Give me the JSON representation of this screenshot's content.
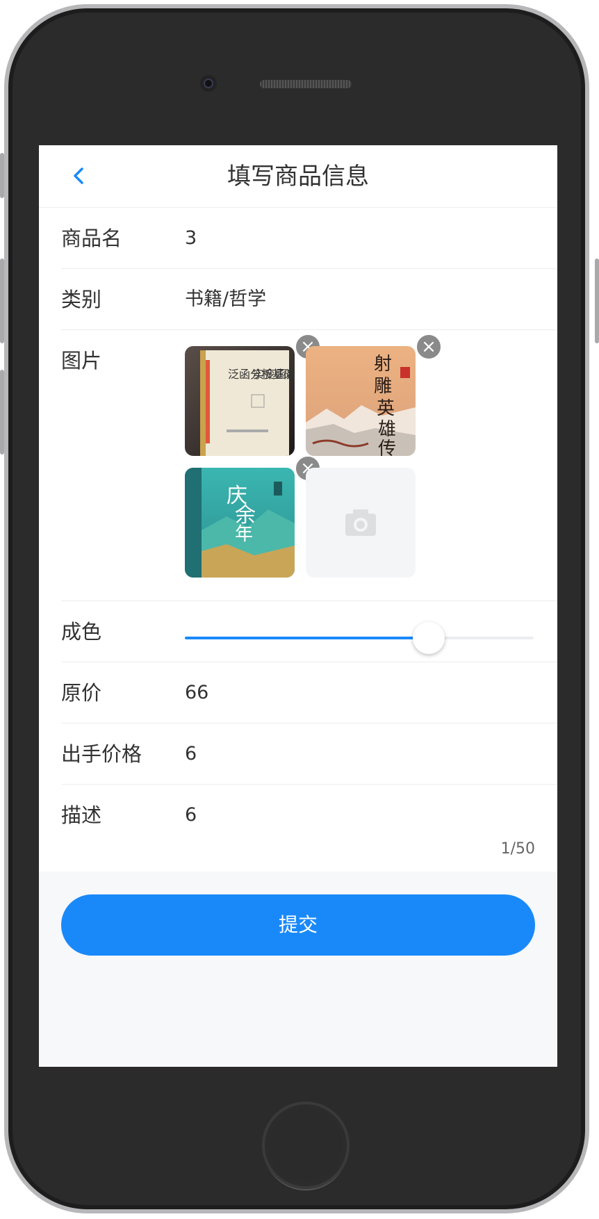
{
  "header": {
    "title": "填写商品信息",
    "back_icon": "chevron-left-icon"
  },
  "form": {
    "name": {
      "label": "商品名",
      "value": "3"
    },
    "category": {
      "label": "类别",
      "value": "书籍/哲学"
    },
    "images": {
      "label": "图片",
      "items": [
        {
          "alt": "实变函数与泛函分析基础 book cover",
          "title": "实变函数与泛函分析基础"
        },
        {
          "alt": "射雕英雄传 book cover",
          "title": "射雕英雄传"
        },
        {
          "alt": "庆余年 book cover",
          "title": "庆余年"
        }
      ],
      "delete_icon": "close-circle-icon",
      "upload_icon": "camera-icon"
    },
    "condition": {
      "label": "成色",
      "value_percent": 70
    },
    "original_price": {
      "label": "原价",
      "value": "66"
    },
    "sale_price": {
      "label": "出手价格",
      "value": "6"
    },
    "description": {
      "label": "描述",
      "value": "6",
      "counter": "1/50"
    }
  },
  "actions": {
    "submit_label": "提交"
  },
  "colors": {
    "accent": "#1989fa",
    "text": "#323233",
    "divider": "#ebedf0"
  }
}
